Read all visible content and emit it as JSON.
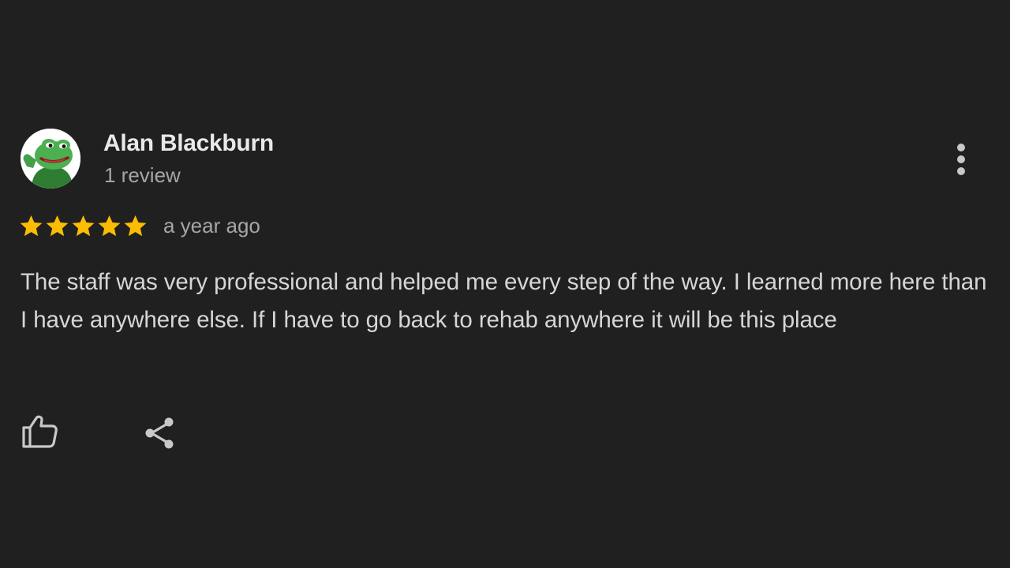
{
  "review": {
    "author": {
      "name": "Alan Blackburn",
      "meta": "1 review",
      "avatar_icon": "frog-avatar-icon"
    },
    "rating": {
      "stars": 5,
      "max": 5,
      "color": "#fbbc04"
    },
    "date": "a year ago",
    "text": "The staff was very professional and helped me every step of the way. I learned more here than I have anywhere else. If I have to go back to rehab anywhere it will be this place",
    "actions": {
      "like_icon": "thumbs-up-icon",
      "share_icon": "share-icon",
      "more_icon": "more-vert-icon"
    }
  },
  "theme": {
    "background": "#202020",
    "primary_text": "#e9e9e9",
    "secondary_text": "#a6a6a6",
    "icon_color": "#c8c8c8"
  }
}
